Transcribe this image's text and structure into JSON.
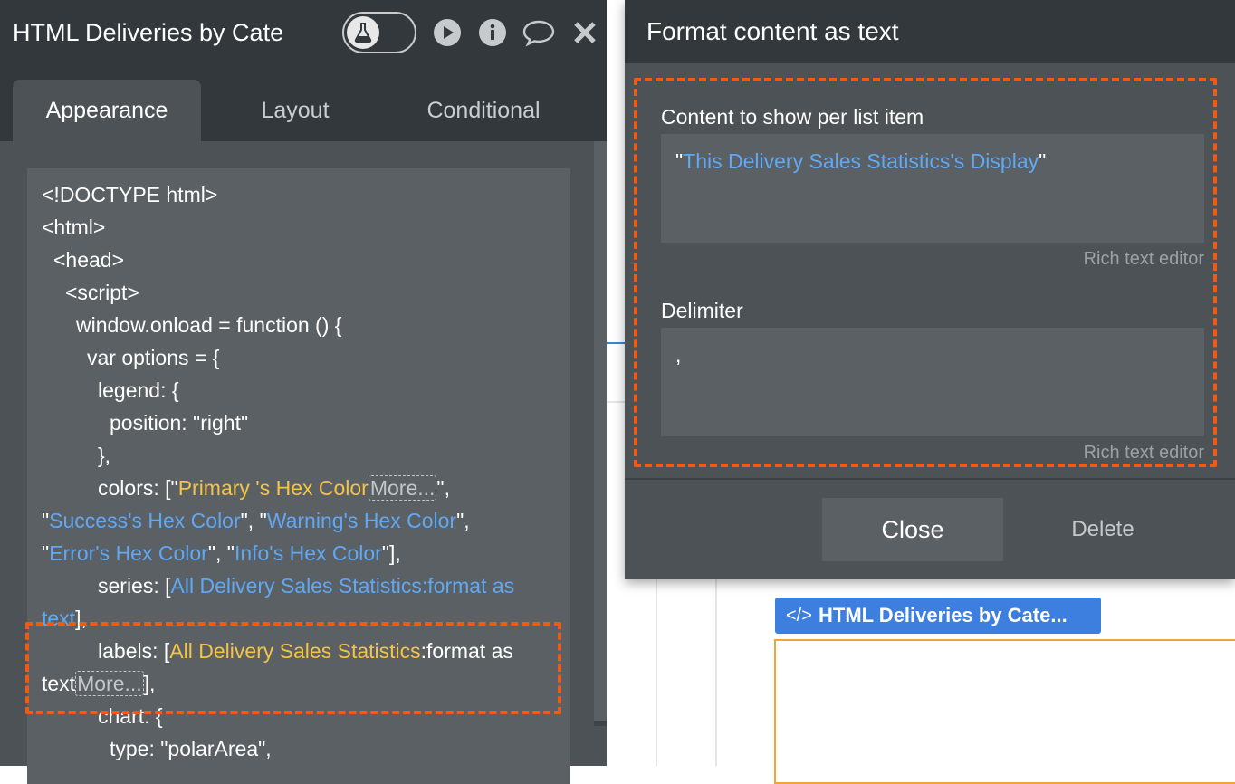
{
  "editor": {
    "element_title": "HTML Deliveries by Cate",
    "tabs": [
      {
        "label": "Appearance",
        "active": true
      },
      {
        "label": "Layout",
        "active": false
      },
      {
        "label": "Conditional",
        "active": false
      }
    ],
    "icons": [
      "test-toggle-flask-icon",
      "preview-play-icon",
      "info-icon",
      "comment-icon",
      "close-icon"
    ],
    "code": {
      "l1": "<!DOCTYPE html>",
      "l2": "<html>",
      "l3": "<head>",
      "l4": "<script>",
      "l5": "window.onload = function () {",
      "l6": "var options = {",
      "l7": "legend: {",
      "l8": "position: \"right\"",
      "l9": "},",
      "l10a": "colors: [\"",
      "l10b": "Primary 's Hex Color",
      "l10c": "More...",
      "l10d": "\",",
      "l11a": "\"",
      "l11b": "Success's Hex Color",
      "l11c": "\", \"",
      "l11d": "Warning's Hex Color",
      "l11e": "\",",
      "l12a": "\"",
      "l12b": "Error's Hex Color",
      "l12c": "\", \"",
      "l12d": "Info's Hex Color",
      "l12e": "\"],",
      "l13a": "series: [",
      "l13b": "All Delivery Sales Statistics:format as",
      "l14a": "text",
      "l14b": "],",
      "l15a": "labels: [",
      "l15b": "All Delivery Sales Statistics",
      "l15c": ":format as",
      "l16a": "text",
      "l16b": "More...",
      "l16c": "],",
      "l17": "chart: {",
      "l18": "type: \"polarArea\","
    }
  },
  "modal": {
    "title": "Format content as text",
    "content_label": "Content to show per list item",
    "content_value_q1": "\"",
    "content_value": "This Delivery Sales Statistics's Display",
    "content_value_q2": "\"",
    "rich_text_1": "Rich text editor",
    "delimiter_label": "Delimiter",
    "delimiter_value": ",",
    "rich_text_2": "Rich text editor",
    "close_label": "Close",
    "delete_label": "Delete"
  },
  "canvas": {
    "element_label": "HTML Deliveries by Cate...",
    "element_icon": "code-brackets-icon"
  },
  "colors": {
    "panel_dark": "#32383c",
    "panel": "#4d5256",
    "field": "#5b6064",
    "dynamic_yellow": "#f3c446",
    "dynamic_blue": "#61a8f3",
    "highlight_orange": "#ef5a14",
    "element_blue": "#3d7fdf"
  }
}
